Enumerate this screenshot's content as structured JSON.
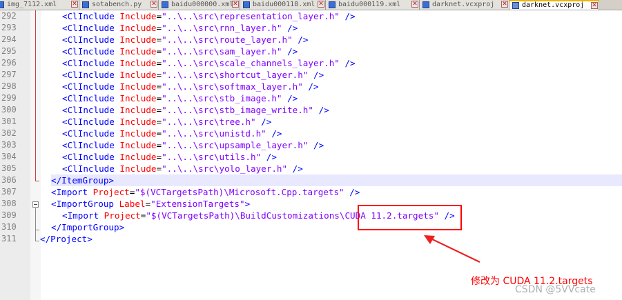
{
  "tabs": [
    {
      "label": "img_7112.xml"
    },
    {
      "label": "sotabench.py"
    },
    {
      "label": "baidu000000.xml"
    },
    {
      "label": "baidu000118.xml"
    },
    {
      "label": "baidu000119.xml"
    },
    {
      "label": "darknet.vcxproj"
    },
    {
      "label": "darknet.vcxproj",
      "active": true
    }
  ],
  "line_numbers": [
    "292",
    "293",
    "294",
    "295",
    "296",
    "297",
    "298",
    "299",
    "300",
    "301",
    "302",
    "303",
    "304",
    "305",
    "306",
    "307",
    "308",
    "309",
    "310",
    "311"
  ],
  "code": {
    "clinclude": {
      "tag": "<ClInclude",
      "attr": "Include",
      "eq": "=",
      "close": " />",
      "values": [
        "\"..\\..\\src\\representation_layer.h\"",
        "\"..\\..\\src\\rnn_layer.h\"",
        "\"..\\..\\src\\route_layer.h\"",
        "\"..\\..\\src\\sam_layer.h\"",
        "\"..\\..\\src\\scale_channels_layer.h\"",
        "\"..\\..\\src\\shortcut_layer.h\"",
        "\"..\\..\\src\\softmax_layer.h\"",
        "\"..\\..\\src\\stb_image.h\"",
        "\"..\\..\\src\\stb_image_write.h\"",
        "\"..\\..\\src\\tree.h\"",
        "\"..\\..\\src\\unistd.h\"",
        "\"..\\..\\src\\upsample_layer.h\"",
        "\"..\\..\\src\\utils.h\"",
        "\"..\\..\\src\\yolo_layer.h\""
      ]
    },
    "line306": "</ItemGroup>",
    "line307": {
      "tag": "<Import",
      "attr": "Project",
      "eq": "=",
      "val": "\"$(VCTargetsPath)\\Microsoft.Cpp.targets\"",
      "close": " />"
    },
    "line308": {
      "tag": "<ImportGroup",
      "attr": "Label",
      "eq": "=",
      "val": "\"ExtensionTargets\"",
      "close": ">"
    },
    "line309": {
      "tag": "<Import",
      "attr": "Project",
      "eq": "=",
      "val": "\"$(VCTargetsPath)\\BuildCustomizations\\CUDA 11.2.targets\"",
      "close": " />"
    },
    "line310": "</ImportGroup>",
    "line311": "</Project>"
  },
  "annotation": {
    "note": "修改为 CUDA 11.2.targets",
    "color": "#ff0000"
  },
  "watermark": "CSDN @5VVcate"
}
